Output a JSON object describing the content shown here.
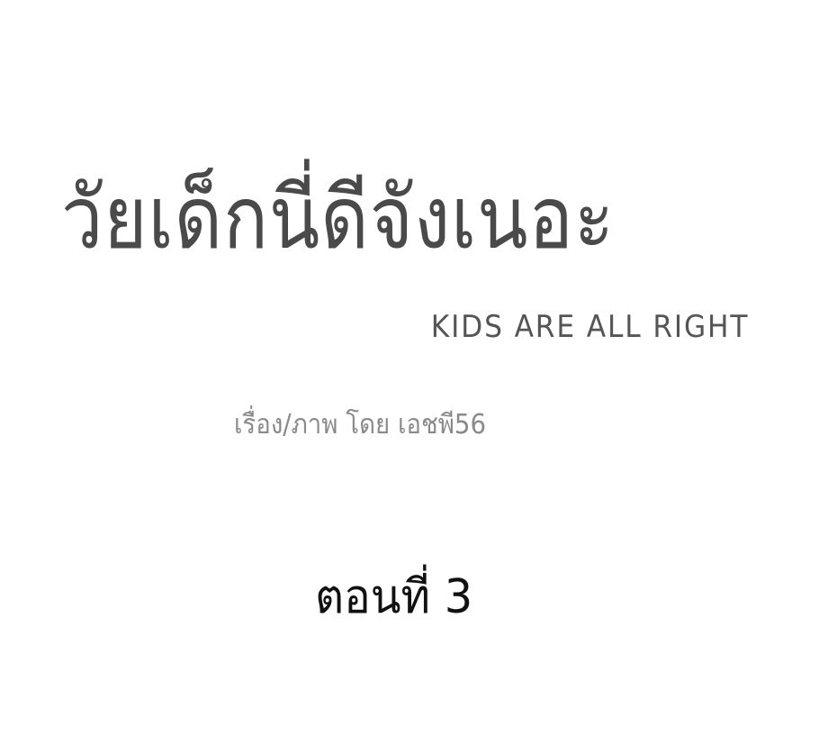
{
  "title": {
    "thai": "วัยเด็กนี่ดีจังเนอะ",
    "english": "KIDS ARE ALL RIGHT"
  },
  "credit": {
    "text": "เรื่อง/ภาพ โดย เอชพี56"
  },
  "episode": {
    "label": "ตอนที่ 3"
  },
  "colors": {
    "background": "#ffffff",
    "title": "#4a4a4a",
    "credit": "#8a8a8a",
    "episode": "#111111"
  }
}
